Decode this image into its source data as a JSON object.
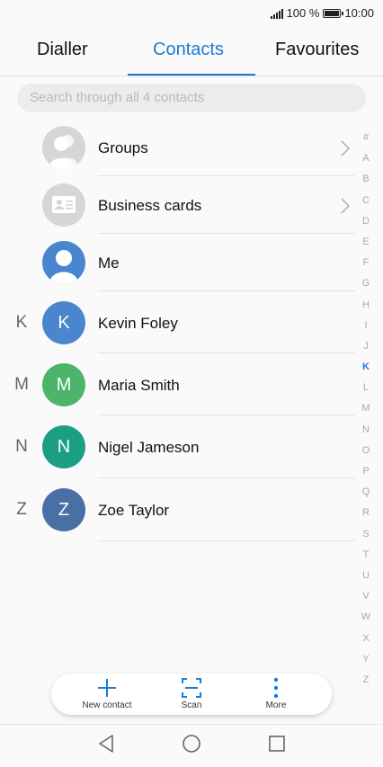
{
  "status": {
    "battery": "100 %",
    "time": "10:00"
  },
  "tabs": [
    {
      "label": "Dialler"
    },
    {
      "label": "Contacts"
    },
    {
      "label": "Favourites"
    }
  ],
  "search": {
    "placeholder": "Search through all 4 contacts"
  },
  "special_rows": [
    {
      "label": "Groups"
    },
    {
      "label": "Business cards"
    },
    {
      "label": "Me"
    }
  ],
  "contacts": [
    {
      "section": "K",
      "initial": "K",
      "name": "Kevin Foley",
      "color": "#4a86d0"
    },
    {
      "section": "M",
      "initial": "M",
      "name": "Maria Smith",
      "color": "#4cb56b"
    },
    {
      "section": "N",
      "initial": "N",
      "name": "Nigel Jameson",
      "color": "#1b9e83"
    },
    {
      "section": "Z",
      "initial": "Z",
      "name": "Zoe Taylor",
      "color": "#4a6fa5"
    }
  ],
  "alphabet": [
    "#",
    "A",
    "B",
    "C",
    "D",
    "E",
    "F",
    "G",
    "H",
    "I",
    "J",
    "K",
    "L",
    "M",
    "N",
    "O",
    "P",
    "Q",
    "R",
    "S",
    "T",
    "U",
    "V",
    "W",
    "X",
    "Y",
    "Z"
  ],
  "alphabet_active": "K",
  "actions": [
    {
      "label": "New contact",
      "icon": "plus-icon"
    },
    {
      "label": "Scan",
      "icon": "scan-icon"
    },
    {
      "label": "More",
      "icon": "more-vertical-icon"
    }
  ],
  "colors": {
    "accent": "#1a7bd6"
  }
}
